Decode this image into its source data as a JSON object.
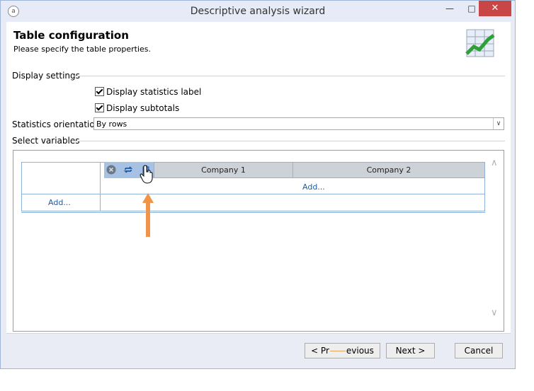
{
  "window": {
    "title": "Descriptive analysis wizard",
    "minimize_icon": "minimize-icon",
    "maximize_icon": "maximize-icon",
    "close_icon": "close-icon"
  },
  "header": {
    "title": "Table configuration",
    "subtitle": "Please specify the table properties.",
    "logo_icon": "chart-logo-icon"
  },
  "display_settings": {
    "section_label": "Display settings",
    "checkboxes": [
      {
        "label": "Display statistics label",
        "checked": true
      },
      {
        "label": "Display subtotals",
        "checked": true
      }
    ]
  },
  "orientation": {
    "label": "Statistics orientation:",
    "value": "By rows"
  },
  "variables": {
    "section_label": "Select variables",
    "columns": [
      "Company 1",
      "Company 2"
    ],
    "add_column_label": "Add...",
    "add_row_label": "Add...",
    "toolbar_icons": [
      "remove-icon",
      "swap-icon",
      "clipboard-icon"
    ]
  },
  "footer": {
    "previous_label_a": "< Pr",
    "previous_label_b": "evious",
    "next_label": "Next >",
    "cancel_label": "Cancel"
  },
  "colors": {
    "accent_arrow": "#f0944a",
    "link": "#1a5dab",
    "toolbar_bg": "#a7c1e2"
  }
}
